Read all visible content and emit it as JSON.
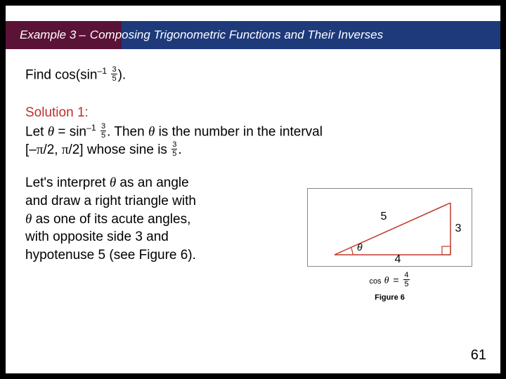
{
  "header": {
    "example_label": "Example 3",
    "dash": "–",
    "title_rest": "Composing Trigonometric Functions and Their Inverses"
  },
  "p1": {
    "t1": "Find cos(sin",
    "sup": "–1",
    "t2": " ",
    "fn": "3",
    "fd": "5",
    "t3": ")."
  },
  "p2": {
    "sol": "Solution 1:",
    "l1a": "Let ",
    "l1b": " = sin",
    "sup": "–1",
    "sp": " ",
    "fn": "3",
    "fd": "5",
    "l1c": ". Then ",
    "l1d": " is the number in the interval",
    "l2a": "[–",
    "l2b": "/2, ",
    "l2c": "/2] whose sine is ",
    "fn2": "3",
    "fd2": "5",
    "l2d": "."
  },
  "p3": {
    "t": "Let's interpret θ as an angle and draw a right triangle with θ as one of its acute angles, with opposite side 3 and hypotenuse 5 (see Figure 6)."
  },
  "p3lines": {
    "a": "Let's interpret ",
    "b": " as an angle",
    "c": "and draw a right triangle with",
    "d": " as one of its acute angles,",
    "e": "with opposite side 3 and",
    "f": "hypotenuse 5 (see Figure 6)."
  },
  "tri": {
    "hyp": "5",
    "opp": "3",
    "adj": "4"
  },
  "caption": {
    "cos": "cos",
    "eq": "=",
    "fn": "4",
    "fd": "5"
  },
  "figlabel": "Figure 6",
  "page": "61"
}
